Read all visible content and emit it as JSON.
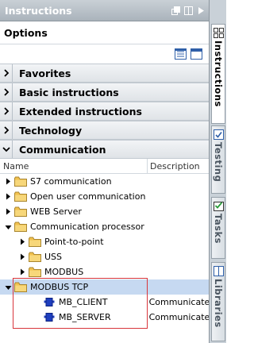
{
  "panel": {
    "title": "Instructions",
    "title_icons": [
      "float-icon",
      "pin-icon",
      "expand-icon"
    ]
  },
  "options": {
    "label": "Options",
    "tool_icons": [
      "list-view-icon",
      "window-icon"
    ]
  },
  "sections": [
    {
      "label": "Favorites",
      "expanded": false
    },
    {
      "label": "Basic instructions",
      "expanded": false
    },
    {
      "label": "Extended instructions",
      "expanded": false
    },
    {
      "label": "Technology",
      "expanded": false
    },
    {
      "label": "Communication",
      "expanded": true
    }
  ],
  "columns": {
    "name": "Name",
    "description": "Description"
  },
  "tree": [
    {
      "label": "S7 communication",
      "description": "",
      "level": 0,
      "expander": "collapsed",
      "icon": "folder-icon"
    },
    {
      "label": "Open user communication",
      "description": "",
      "level": 0,
      "expander": "collapsed",
      "icon": "folder-icon"
    },
    {
      "label": "WEB Server",
      "description": "",
      "level": 0,
      "expander": "collapsed",
      "icon": "folder-icon"
    },
    {
      "label": "Communication processor",
      "description": "",
      "level": 0,
      "expander": "expanded",
      "icon": "folder-icon"
    },
    {
      "label": "Point-to-point",
      "description": "",
      "level": 1,
      "expander": "collapsed",
      "icon": "folder-icon"
    },
    {
      "label": "USS",
      "description": "",
      "level": 1,
      "expander": "collapsed",
      "icon": "folder-icon"
    },
    {
      "label": "MODBUS",
      "description": "",
      "level": 1,
      "expander": "collapsed",
      "icon": "folder-icon"
    },
    {
      "label": "MODBUS TCP",
      "description": "",
      "level": 0,
      "expander": "expanded",
      "icon": "folder-icon",
      "selected": true
    },
    {
      "label": "MB_CLIENT",
      "description": "Communicate",
      "level": 2,
      "expander": "none",
      "icon": "function-block-icon"
    },
    {
      "label": "MB_SERVER",
      "description": "Communicate",
      "level": 2,
      "expander": "none",
      "icon": "function-block-icon"
    }
  ],
  "sidebar_tabs": [
    {
      "label": "Instructions",
      "icon": "instructions-icon",
      "active": true
    },
    {
      "label": "Testing",
      "icon": "testing-icon",
      "active": false
    },
    {
      "label": "Tasks",
      "icon": "tasks-icon",
      "active": false
    },
    {
      "label": "Libraries",
      "icon": "libraries-icon",
      "active": false
    }
  ],
  "colors": {
    "selection": "#c6d9f1",
    "highlight_border": "#d8353b",
    "folder": "#f2c14e",
    "block": "#1f3fbf"
  }
}
